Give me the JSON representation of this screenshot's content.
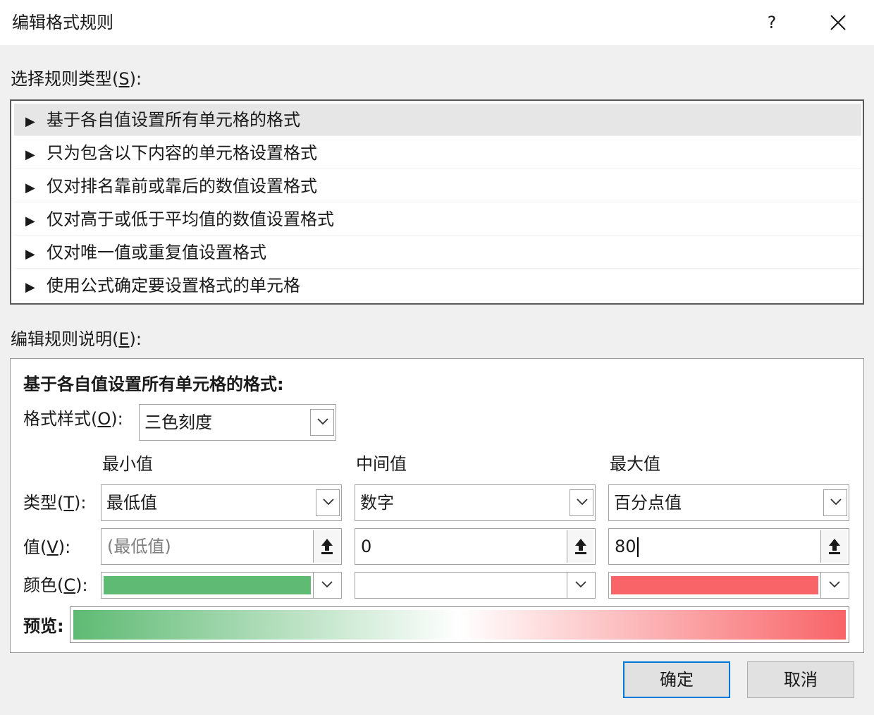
{
  "window": {
    "title": "编辑格式规则",
    "help_label": "?"
  },
  "rule_type": {
    "label": "选择规则类型(S):",
    "label_parts": [
      "选择规则类型(",
      "S",
      "):"
    ],
    "items": [
      {
        "label": "基于各自值设置所有单元格的格式",
        "selected": true
      },
      {
        "label": "只为包含以下内容的单元格设置格式",
        "selected": false
      },
      {
        "label": "仅对排名靠前或靠后的数值设置格式",
        "selected": false
      },
      {
        "label": "仅对高于或低于平均值的数值设置格式",
        "selected": false
      },
      {
        "label": "仅对唯一值或重复值设置格式",
        "selected": false
      },
      {
        "label": "使用公式确定要设置格式的单元格",
        "selected": false
      }
    ],
    "arrow_glyph": "▶"
  },
  "description": {
    "label": "编辑规则说明(E):",
    "label_parts": [
      "编辑规则说明(",
      "E",
      "):"
    ],
    "heading": "基于各自值设置所有单元格的格式:",
    "format_style": {
      "label_parts": [
        "格式样式(",
        "O",
        "):"
      ],
      "value": "三色刻度"
    },
    "row_labels": {
      "type": [
        "类型(",
        "T",
        "):"
      ],
      "value": [
        "值(",
        "V",
        "):"
      ],
      "color": [
        "颜色(",
        "C",
        "):"
      ]
    },
    "columns": [
      {
        "header": "最小值",
        "type": "最低值",
        "value": "(最低值)",
        "value_is_placeholder": true,
        "color": "#5fba73"
      },
      {
        "header": "中间值",
        "type": "数字",
        "value": "0",
        "value_is_placeholder": false,
        "color": "#ffffff"
      },
      {
        "header": "最大值",
        "type": "百分点值",
        "value": "80",
        "value_is_placeholder": false,
        "color": "#f86468"
      }
    ],
    "preview_label": "预览:"
  },
  "buttons": {
    "ok": "确定",
    "cancel": "取消"
  }
}
